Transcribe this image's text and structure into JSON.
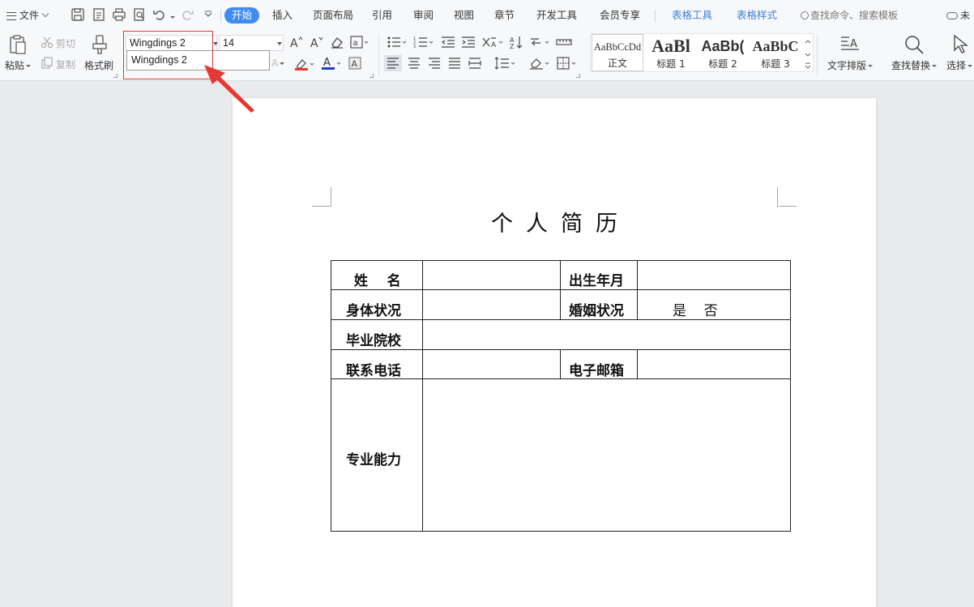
{
  "menubar": {
    "file_label": "文件",
    "tabs": [
      {
        "label": "开始",
        "active": true
      },
      {
        "label": "插入"
      },
      {
        "label": "页面布局"
      },
      {
        "label": "引用"
      },
      {
        "label": "审阅"
      },
      {
        "label": "视图"
      },
      {
        "label": "章节"
      },
      {
        "label": "开发工具"
      },
      {
        "label": "会员专享"
      }
    ],
    "context_tabs": [
      {
        "label": "表格工具"
      },
      {
        "label": "表格样式"
      }
    ],
    "search_placeholder": "查找命令、搜索模板",
    "cloud_label": "未"
  },
  "ribbon": {
    "paste_label": "粘贴",
    "cut_label": "剪切",
    "copy_label": "复制",
    "format_painter_label": "格式刷",
    "font_name": "Wingdings 2",
    "font_size": "14",
    "font_dropdown_item": "Wingdings 2",
    "styles": [
      {
        "sample": "AaBbCcDd",
        "name": "正文"
      },
      {
        "sample": "AaBl",
        "name": "标题 1"
      },
      {
        "sample": "AaBb(",
        "name": "标题 2"
      },
      {
        "sample": "AaBbC",
        "name": "标题 3"
      }
    ],
    "text_layout_label": "文字排版",
    "find_replace_label": "查找替换",
    "select_label": "选择"
  },
  "colors": {
    "accent": "#3f8cf5",
    "context_tab": "#3f7fd9",
    "highlight": "#e53935",
    "font_color_red": "#e53935",
    "font_color_blue": "#1e40c8"
  },
  "document": {
    "title": "个人简历",
    "rows": [
      {
        "label1": "姓    名",
        "label2": "出生年月"
      },
      {
        "label1": "身体状况",
        "label2": "婚姻状况",
        "value2": "是    否"
      },
      {
        "label1": "毕业院校"
      },
      {
        "label1": "联系电话",
        "label2": "电子邮箱"
      },
      {
        "label1": "专业能力"
      }
    ]
  }
}
